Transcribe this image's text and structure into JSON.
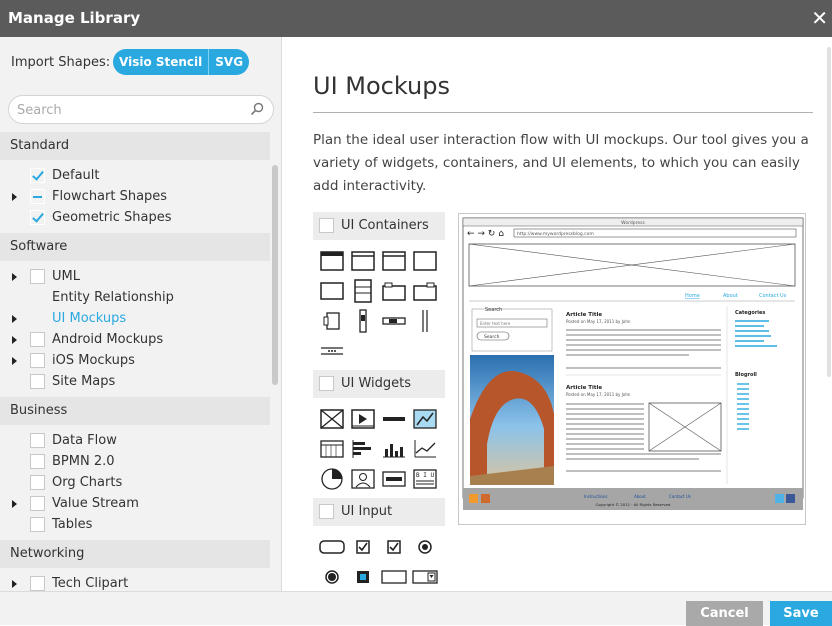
{
  "dialog": {
    "title": "Manage Library",
    "close_glyph": "✕"
  },
  "import": {
    "label": "Import Shapes:",
    "options": [
      "Visio Stencil",
      "SVG"
    ]
  },
  "search": {
    "placeholder": "Search"
  },
  "categories": [
    {
      "name": "Standard",
      "items": [
        {
          "label": "Default",
          "state": "checked",
          "expand": false
        },
        {
          "label": "Flowchart Shapes",
          "state": "partial",
          "expand": true
        },
        {
          "label": "Geometric Shapes",
          "state": "checked",
          "expand": false
        }
      ]
    },
    {
      "name": "Software",
      "items": [
        {
          "label": "UML",
          "state": "unchecked",
          "expand": true
        },
        {
          "label": "Entity Relationship",
          "state": "none",
          "expand": false
        },
        {
          "label": "UI Mockups",
          "state": "none",
          "expand": true,
          "active": true
        },
        {
          "label": "Android Mockups",
          "state": "unchecked",
          "expand": true
        },
        {
          "label": "iOS Mockups",
          "state": "unchecked",
          "expand": true
        },
        {
          "label": "Site Maps",
          "state": "unchecked",
          "expand": false
        }
      ]
    },
    {
      "name": "Business",
      "items": [
        {
          "label": "Data Flow",
          "state": "unchecked",
          "expand": false
        },
        {
          "label": "BPMN 2.0",
          "state": "unchecked",
          "expand": false
        },
        {
          "label": "Org Charts",
          "state": "unchecked",
          "expand": false
        },
        {
          "label": "Value Stream",
          "state": "unchecked",
          "expand": true
        },
        {
          "label": "Tables",
          "state": "unchecked",
          "expand": false
        }
      ]
    },
    {
      "name": "Networking",
      "items": [
        {
          "label": "Tech Clipart",
          "state": "unchecked",
          "expand": true
        }
      ]
    }
  ],
  "detail": {
    "title": "UI Mockups",
    "description": "Plan the ideal user interaction flow with UI mockups. Our tool gives you a variety of widgets, containers, and UI elements, to which you can easily add interactivity.",
    "sections": [
      "UI Containers",
      "UI Widgets",
      "UI Input"
    ]
  },
  "preview": {
    "browser_url": "http://www.mywordpressblog.com",
    "window_title": "Wordpress",
    "nav_links": [
      "Home",
      "About",
      "Contact Us"
    ],
    "search_label": "Search",
    "search_placeholder": "Enter text here",
    "search_button": "Search",
    "article_title": "Article Title",
    "posted": "Posted on May 17, 2011 by John",
    "sidebar_categories": "Categories",
    "sidebar_blogroll": "Blogroll",
    "footer_links": [
      "Instructions",
      "About",
      "Contact Us"
    ],
    "copyright": "Copyright © 2011 · All Rights Reserved"
  },
  "footer": {
    "cancel_label": "Cancel",
    "save_label": "Save"
  },
  "colors": {
    "accent": "#29a9e0",
    "titlebar": "#5b5b5b",
    "cancel": "#a9a9a9"
  }
}
